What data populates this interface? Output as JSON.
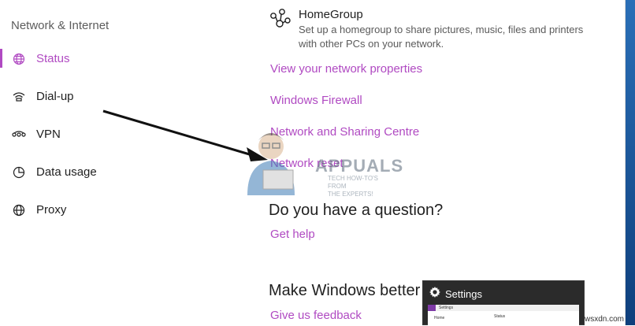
{
  "sidebar": {
    "heading": "Network & Internet",
    "items": [
      {
        "label": "Status",
        "icon": "globe-icon",
        "active": true
      },
      {
        "label": "Dial-up",
        "icon": "dial-up-icon",
        "active": false
      },
      {
        "label": "VPN",
        "icon": "vpn-icon",
        "active": false
      },
      {
        "label": "Data usage",
        "icon": "data-usage-icon",
        "active": false
      },
      {
        "label": "Proxy",
        "icon": "globe-icon",
        "active": false
      }
    ]
  },
  "main": {
    "homegroup": {
      "title": "HomeGroup",
      "description": "Set up a homegroup to share pictures, music, files and printers with other PCs on your network.",
      "icon": "homegroup-icon"
    },
    "links": {
      "view_properties": "View your network properties",
      "firewall": "Windows Firewall",
      "sharing_centre": "Network and Sharing Centre",
      "network_reset": "Network reset"
    },
    "question": {
      "heading": "Do you have a question?",
      "link": "Get help"
    },
    "feedback": {
      "heading": "Make Windows better",
      "link": "Give us feedback"
    }
  },
  "watermark": {
    "brand": "APPUALS",
    "tagline_1": "TECH HOW-TO'S FROM",
    "tagline_2": "THE EXPERTS!"
  },
  "preview": {
    "title": "Settings",
    "icon": "gear-icon",
    "thumb_title": "Settings",
    "thumb_home": "Home",
    "thumb_status": "Status"
  },
  "site": "wsxdn.com",
  "colors": {
    "accent": "#b04ac2",
    "text": "#1f1f1f",
    "secondary_text": "#5a5a5a"
  }
}
